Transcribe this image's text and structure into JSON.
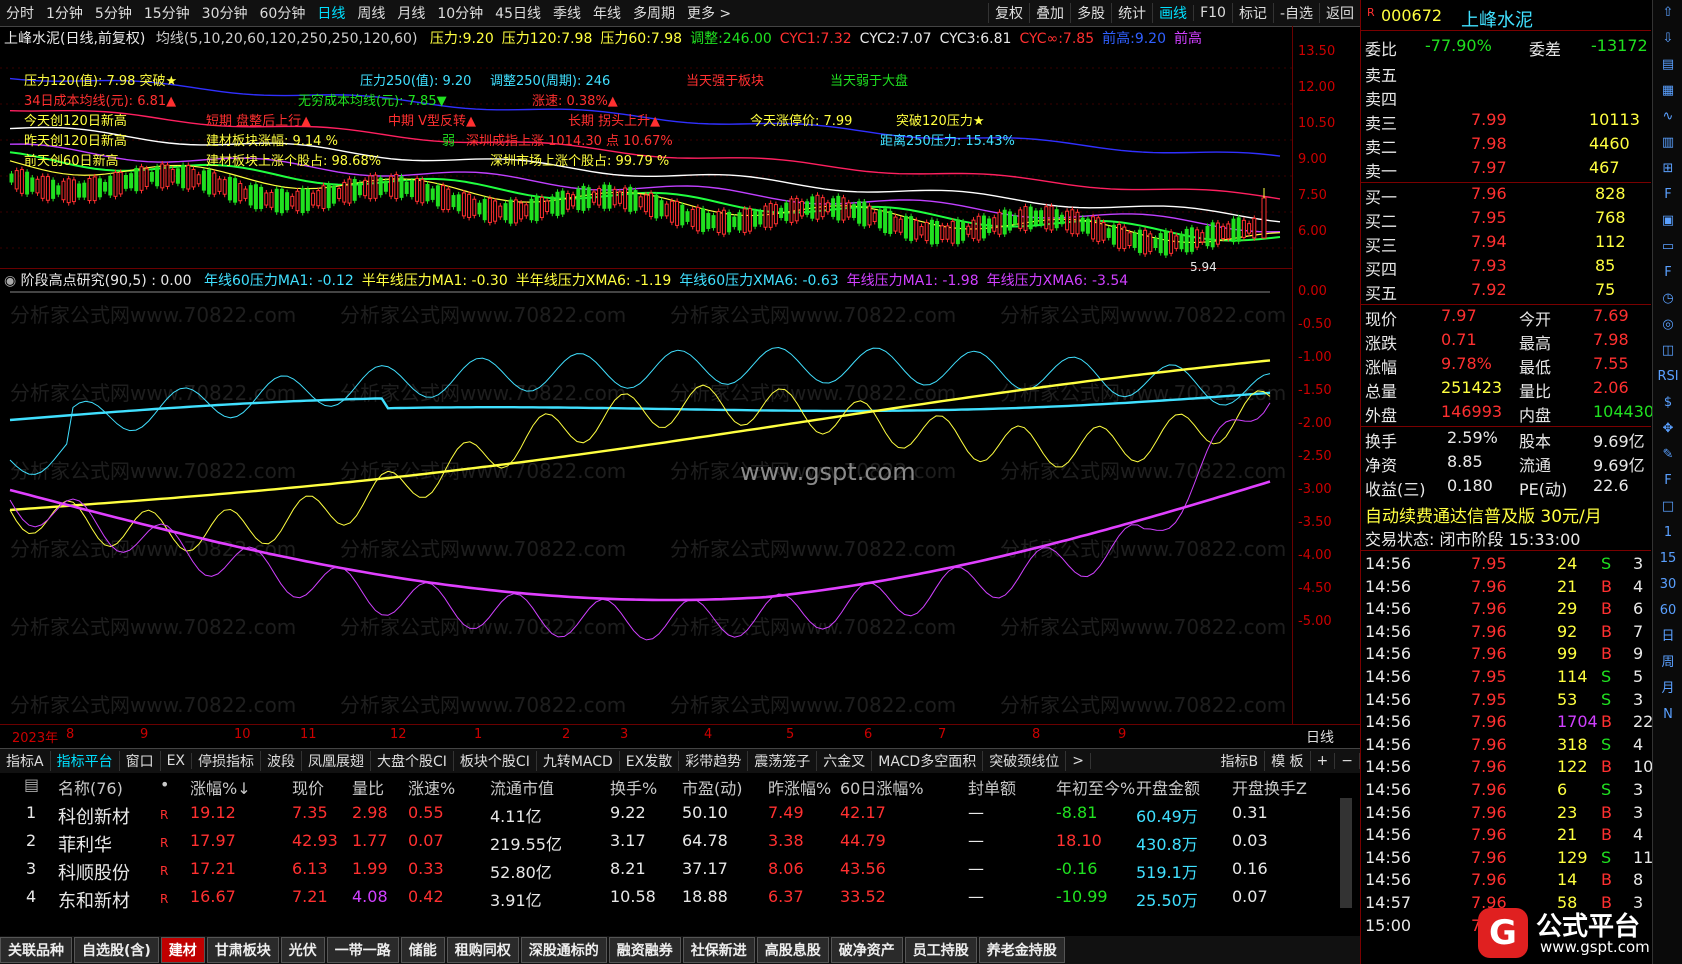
{
  "topbar": {
    "periods": [
      "分时",
      "1分钟",
      "5分钟",
      "15分钟",
      "30分钟",
      "60分钟",
      "日线",
      "周线",
      "月线",
      "10分钟",
      "45日线",
      "季线",
      "年线",
      "多周期",
      "更多 >"
    ],
    "active": 6,
    "tools": [
      "复权",
      "叠加",
      "多股",
      "统计",
      "画线",
      "F10",
      "标记",
      "-自选",
      "返回"
    ]
  },
  "main_chart": {
    "title_line": "上峰水泥(日线,前复权)",
    "indicator_line": "均线(5,10,20,60,120,250,250,120,60)",
    "values": [
      {
        "t": "压力:9.20",
        "c": "#ffff40"
      },
      {
        "t": "压力120:7.98",
        "c": "#ffff40"
      },
      {
        "t": "压力60:7.98",
        "c": "#ffff40"
      },
      {
        "t": "调整:246.00",
        "c": "#20e020"
      },
      {
        "t": "CYC1:7.32",
        "c": "#ff3030"
      },
      {
        "t": "CYC2:7.07",
        "c": "#e8e8e8"
      },
      {
        "t": "CYC3:6.81",
        "c": "#e8e8e8"
      },
      {
        "t": "CYC∞:7.85",
        "c": "#ff3030"
      },
      {
        "t": "前高:9.20",
        "c": "#3060ff"
      },
      {
        "t": "前高",
        "c": "#d040ff"
      }
    ],
    "annotations": [
      {
        "t": "压力120(值): 7.98  突破★",
        "c": "#ffff40"
      },
      {
        "t": "压力250(值): 9.20",
        "c": "#40e0ff"
      },
      {
        "t": "调整250(周期): 246",
        "c": "#40e0ff"
      },
      {
        "t": "当天强于板块",
        "c": "#ff3030"
      },
      {
        "t": "当天弱于大盘",
        "c": "#20e020"
      },
      {
        "t": "34日成本均线(元): 6.81▲",
        "c": "#ff3030"
      },
      {
        "t": "无穷成本均线(元): 7.85▼",
        "c": "#20e020"
      },
      {
        "t": "涨速: 0.38%▲",
        "c": "#ff3030"
      },
      {
        "t": "今天创120日新高",
        "c": "#ffff40"
      },
      {
        "t": "短期 盘整后上行▲",
        "c": "#ff3030"
      },
      {
        "t": "中期 V型反转▲",
        "c": "#ff3030"
      },
      {
        "t": "长期 拐头上升▲",
        "c": "#ff3030"
      },
      {
        "t": "今天涨停价: 7.99",
        "c": "#ffff40"
      },
      {
        "t": "突破120压力★",
        "c": "#ffff40"
      },
      {
        "t": "昨天创120日新高",
        "c": "#ffff40"
      },
      {
        "t": "建材板块涨幅: 9.14 %",
        "c": "#ffff40"
      },
      {
        "t": "弱",
        "c": "#20e020"
      },
      {
        "t": "深圳成指上涨 1014.30 点 10.67%",
        "c": "#ff3030"
      },
      {
        "t": "距离250压力: 15.43%",
        "c": "#40e0ff"
      },
      {
        "t": "前天创60日新高",
        "c": "#ffff40"
      },
      {
        "t": "建材板块上涨个股占: 98.68%",
        "c": "#ffff40"
      },
      {
        "t": "深圳市场上涨个股占: 99.79 %",
        "c": "#ffff40"
      }
    ],
    "low_label": "5.94",
    "y_ticks": [
      "13.50",
      "12.00",
      "10.50",
      "9.00",
      "7.50",
      "6.00"
    ]
  },
  "sub_chart": {
    "title": "阶段高点研究(90,5) : 0.00",
    "values": [
      {
        "t": "年线60压力MA1: -0.12",
        "c": "#40e0ff"
      },
      {
        "t": "半年线压力MA1: -0.30",
        "c": "#ffff40"
      },
      {
        "t": "半年线压力XMA6: -1.19",
        "c": "#ffff40"
      },
      {
        "t": "年线60压力XMA6: -0.63",
        "c": "#40e0ff"
      },
      {
        "t": "年线压力MA1: -1.98",
        "c": "#d040ff"
      },
      {
        "t": "年线压力XMA6: -3.54",
        "c": "#d040ff"
      }
    ],
    "y_ticks": [
      "0.00",
      "-0.50",
      "-1.00",
      "-1.50",
      "-2.00",
      "-2.50",
      "-3.00",
      "-3.50",
      "-4.00",
      "-4.50",
      "-5.00"
    ],
    "watermark": "www.gspt.com",
    "bg_watermark": "分析家公式网www.70822.com"
  },
  "time_axis": {
    "labels": [
      "2023年",
      "8",
      "9",
      "10",
      "11",
      "12",
      "1",
      "2",
      "3",
      "4",
      "5",
      "6",
      "7",
      "8",
      "9"
    ],
    "right": "日线"
  },
  "tabs": {
    "items": [
      "指标A",
      "指标平台",
      "窗口",
      "EX",
      "停损指标",
      "波段",
      "凤凰展翅",
      "大盘个股CI",
      "板块个股CI",
      "九转MACD",
      "EX发散",
      "彩带趋势",
      "震荡笼子",
      "六金叉",
      "MACD多空面积",
      "突破颈线位",
      ">"
    ],
    "active": 1,
    "right": [
      "指标B",
      "模 板",
      "+",
      "−"
    ]
  },
  "table": {
    "headers": [
      "名称(76)",
      "•",
      "涨幅%↓",
      "现价",
      "量比",
      "涨速%",
      "流通市值",
      "换手%",
      "市盈(动)",
      "昨涨幅%",
      "60日涨幅%",
      "封单额",
      "年初至今%",
      "开盘金额",
      "开盘换手Z"
    ],
    "rows": [
      {
        "no": "1",
        "name": "科创新材",
        "r": "R",
        "chg": "19.12",
        "price": "7.35",
        "vr": "2.98",
        "spd": "0.55",
        "cap": "4.11亿",
        "turn": "9.22",
        "pe": "50.10",
        "ychg": "7.49",
        "d60": "42.17",
        "seal": "—",
        "ytd": "-8.81",
        "open_amt": "60.49万",
        "open_turn": "0.31"
      },
      {
        "no": "2",
        "name": "菲利华",
        "r": "R",
        "chg": "17.97",
        "price": "42.93",
        "vr": "1.77",
        "spd": "0.07",
        "cap": "219.55亿",
        "turn": "3.17",
        "pe": "64.78",
        "ychg": "3.38",
        "d60": "44.79",
        "seal": "—",
        "ytd": "18.10",
        "open_amt": "430.8万",
        "open_turn": "0.03"
      },
      {
        "no": "3",
        "name": "科顺股份",
        "r": "R",
        "chg": "17.21",
        "price": "6.13",
        "vr": "1.99",
        "spd": "0.33",
        "cap": "52.80亿",
        "turn": "8.21",
        "pe": "37.17",
        "ychg": "8.06",
        "d60": "43.56",
        "seal": "—",
        "ytd": "-0.16",
        "open_amt": "519.1万",
        "open_turn": "0.16"
      },
      {
        "no": "4",
        "name": "东和新材",
        "r": "R",
        "chg": "16.67",
        "price": "7.21",
        "vr": "4.08",
        "spd": "0.42",
        "cap": "3.91亿",
        "turn": "10.58",
        "pe": "18.88",
        "ychg": "6.37",
        "d60": "33.52",
        "seal": "—",
        "ytd": "-10.99",
        "open_amt": "25.50万",
        "open_turn": "0.07"
      }
    ]
  },
  "bottom_tabs": {
    "items": [
      "关联品种",
      "自选股(含)",
      "建材",
      "甘肃板块",
      "光伏",
      "一带一路",
      "储能",
      "租购同权",
      "深股通标的",
      "融资融券",
      "社保新进",
      "高股息股",
      "破净资产",
      "员工持股",
      "养老金持股"
    ],
    "active": 2
  },
  "quote": {
    "code": "000672",
    "name": "上峰水泥",
    "ratio": {
      "l": "委比",
      "v": "-77.90%",
      "l2": "委差",
      "v2": "-13172"
    },
    "asks": [
      {
        "l": "卖五",
        "p": "",
        "v": ""
      },
      {
        "l": "卖四",
        "p": "",
        "v": ""
      },
      {
        "l": "卖三",
        "p": "7.99",
        "v": "10113"
      },
      {
        "l": "卖二",
        "p": "7.98",
        "v": "4460"
      },
      {
        "l": "卖一",
        "p": "7.97",
        "v": "467"
      }
    ],
    "bids": [
      {
        "l": "买一",
        "p": "7.96",
        "v": "828"
      },
      {
        "l": "买二",
        "p": "7.95",
        "v": "768"
      },
      {
        "l": "买三",
        "p": "7.94",
        "v": "112"
      },
      {
        "l": "买四",
        "p": "7.93",
        "v": "85"
      },
      {
        "l": "买五",
        "p": "7.92",
        "v": "75"
      }
    ],
    "stats": [
      {
        "l": "现价",
        "v": "7.97",
        "l2": "今开",
        "v2": "7.69"
      },
      {
        "l": "涨跌",
        "v": "0.71",
        "l2": "最高",
        "v2": "7.98"
      },
      {
        "l": "涨幅",
        "v": "9.78%",
        "l2": "最低",
        "v2": "7.55"
      },
      {
        "l": "总量",
        "v": "251423",
        "l2": "量比",
        "v2": "2.06"
      },
      {
        "l": "外盘",
        "v": "146993",
        "l2": "内盘",
        "v2": "104430"
      }
    ],
    "stats2": [
      {
        "l": "换手",
        "v": "2.59%",
        "l2": "股本",
        "v2": "9.69亿"
      },
      {
        "l": "净资",
        "v": "8.85",
        "l2": "流通",
        "v2": "9.69亿"
      },
      {
        "l": "收益(三)",
        "v": "0.180",
        "l2": "PE(动)",
        "v2": "22.6"
      }
    ],
    "promo": "自动续费通达信普及版  30元/月",
    "status": "交易状态: 闭市阶段 15:33:00",
    "ticks": [
      [
        "14:56",
        "7.95",
        "24",
        "S",
        "3"
      ],
      [
        "14:56",
        "7.96",
        "21",
        "B",
        "4"
      ],
      [
        "14:56",
        "7.96",
        "29",
        "B",
        "6"
      ],
      [
        "14:56",
        "7.96",
        "92",
        "B",
        "7"
      ],
      [
        "14:56",
        "7.96",
        "99",
        "B",
        "9"
      ],
      [
        "14:56",
        "7.95",
        "114",
        "S",
        "5"
      ],
      [
        "14:56",
        "7.95",
        "53",
        "S",
        "3"
      ],
      [
        "14:56",
        "7.96",
        "1704",
        "B",
        "22"
      ],
      [
        "14:56",
        "7.96",
        "318",
        "S",
        "4"
      ],
      [
        "14:56",
        "7.96",
        "122",
        "B",
        "10"
      ],
      [
        "14:56",
        "7.96",
        "6",
        "S",
        "3"
      ],
      [
        "14:56",
        "7.96",
        "23",
        "B",
        "3"
      ],
      [
        "14:56",
        "7.96",
        "21",
        "B",
        "4"
      ],
      [
        "14:56",
        "7.96",
        "129",
        "S",
        "11"
      ],
      [
        "14:56",
        "7.96",
        "14",
        "B",
        "8"
      ],
      [
        "14:57",
        "7.96",
        "58",
        "B",
        "3"
      ],
      [
        "15:00",
        "7",
        "",
        "",
        " "
      ]
    ]
  },
  "side_tools": [
    "⇧",
    "⇩",
    "▤",
    "▦",
    "∿",
    "▥",
    "⊞",
    "F",
    "▣",
    "▭",
    "F",
    "◷",
    "◎",
    "◫",
    "RSI",
    "$",
    "✥",
    "✎",
    "F",
    "□",
    "1",
    "15",
    "30",
    "60",
    "日",
    "周",
    "月",
    "N"
  ],
  "logo": {
    "text": "公式平台",
    "url": "www.gspt.com"
  },
  "colors": {
    "up": "#ff3030",
    "down": "#20e020",
    "accent": "#00e0ff",
    "grid": "#6a0000"
  }
}
